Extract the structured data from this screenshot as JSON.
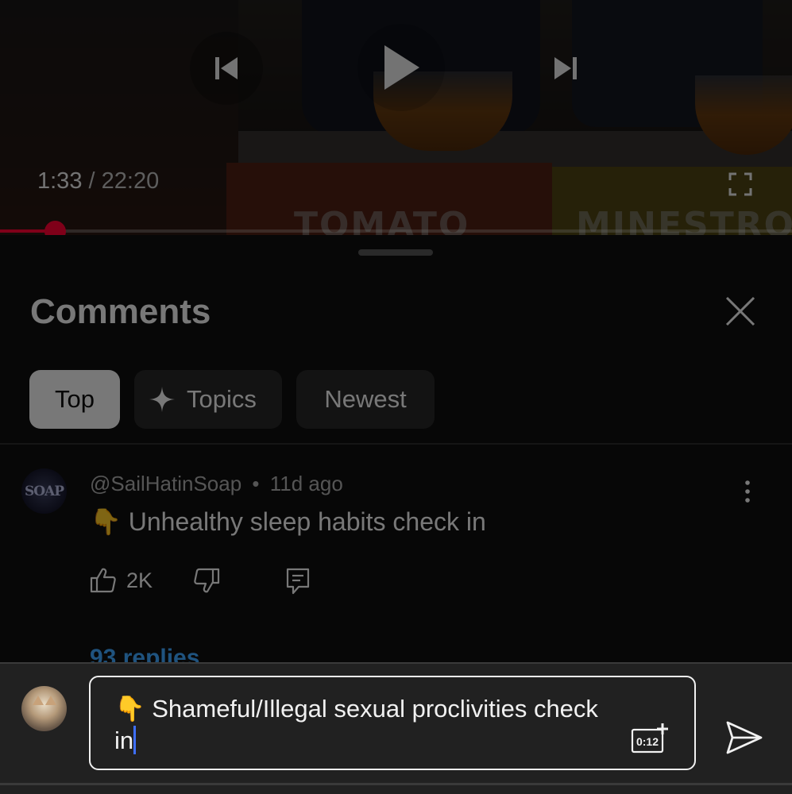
{
  "player": {
    "current_time": "1:33",
    "time_separator": "/",
    "duration": "22:20",
    "progress_fraction": 0.0695,
    "box_label_1": "TOMATO",
    "box_label_2": "MINESTRO"
  },
  "comments": {
    "title": "Comments",
    "filters": [
      {
        "label": "Top",
        "selected": true
      },
      {
        "label": "Topics",
        "selected": false
      },
      {
        "label": "Newest",
        "selected": false
      }
    ],
    "items": [
      {
        "avatar_text": "SOAP",
        "author": "@SailHatinSoap",
        "dot": "•",
        "age": "11d ago",
        "text": "👇 Unhealthy sleep habits check in",
        "likes": "2K",
        "replies": "93 replies"
      }
    ]
  },
  "composer": {
    "value": "👇 Shameful/Illegal sexual proclivities check in",
    "timestamp_button_label": "0:12"
  },
  "colors": {
    "accent": "#ff0033",
    "link": "#3ea6ff",
    "caret": "#3e6fff"
  }
}
